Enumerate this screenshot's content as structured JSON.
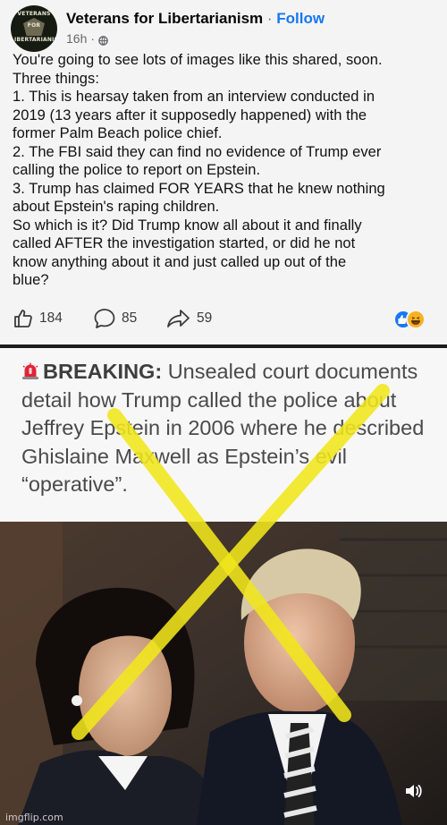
{
  "post": {
    "page_name": "Veterans for Libertarianism",
    "separator": " · ",
    "follow_label": "Follow",
    "time_ago": "16h",
    "meta_dot": "·",
    "avatar_lines": [
      "VETERANS",
      "FOR",
      "LIBERTARIANISM"
    ],
    "body": "You're going to see lots of images like this shared, soon.\nThree things:\n1. This is hearsay taken from an interview conducted in\n2019 (13 years after it supposedly happened) with the\nformer Palm Beach police chief.\n2. The FBI said they can find no evidence of Trump ever\ncalling the police to report on Epstein.\n3. Trump has claimed FOR YEARS that he knew nothing\nabout Epstein's raping children.\nSo which is it? Did Trump know all about it and finally\ncalled AFTER the investigation started, or did he not\nknow anything about it and just called up out of the\nblue?",
    "counts": {
      "likes": "184",
      "comments": "85",
      "shares": "59"
    },
    "icons": {
      "like": "thumbs-up-icon",
      "comment": "comment-icon",
      "share": "share-icon",
      "reactions": [
        "like-reaction-icon",
        "haha-reaction-icon"
      ],
      "privacy": "globe-icon"
    }
  },
  "meme": {
    "headline_keyword": "BREAKING:",
    "headline_rest": " Unsealed court documents detail how Trump called the police about Jeffrey Epstein in 2006 where he described Ghislaine Maxwell as Epstein’s evil “operative”.",
    "siren_icon": "siren-icon",
    "overlay": "yellow-x-mark",
    "mute_icon": "speaker-icon",
    "watermark": "imgflip.com"
  },
  "colors": {
    "accent": "#1877f2",
    "post_bg": "#f4f4f4",
    "x_mark": "#f2e71c"
  }
}
